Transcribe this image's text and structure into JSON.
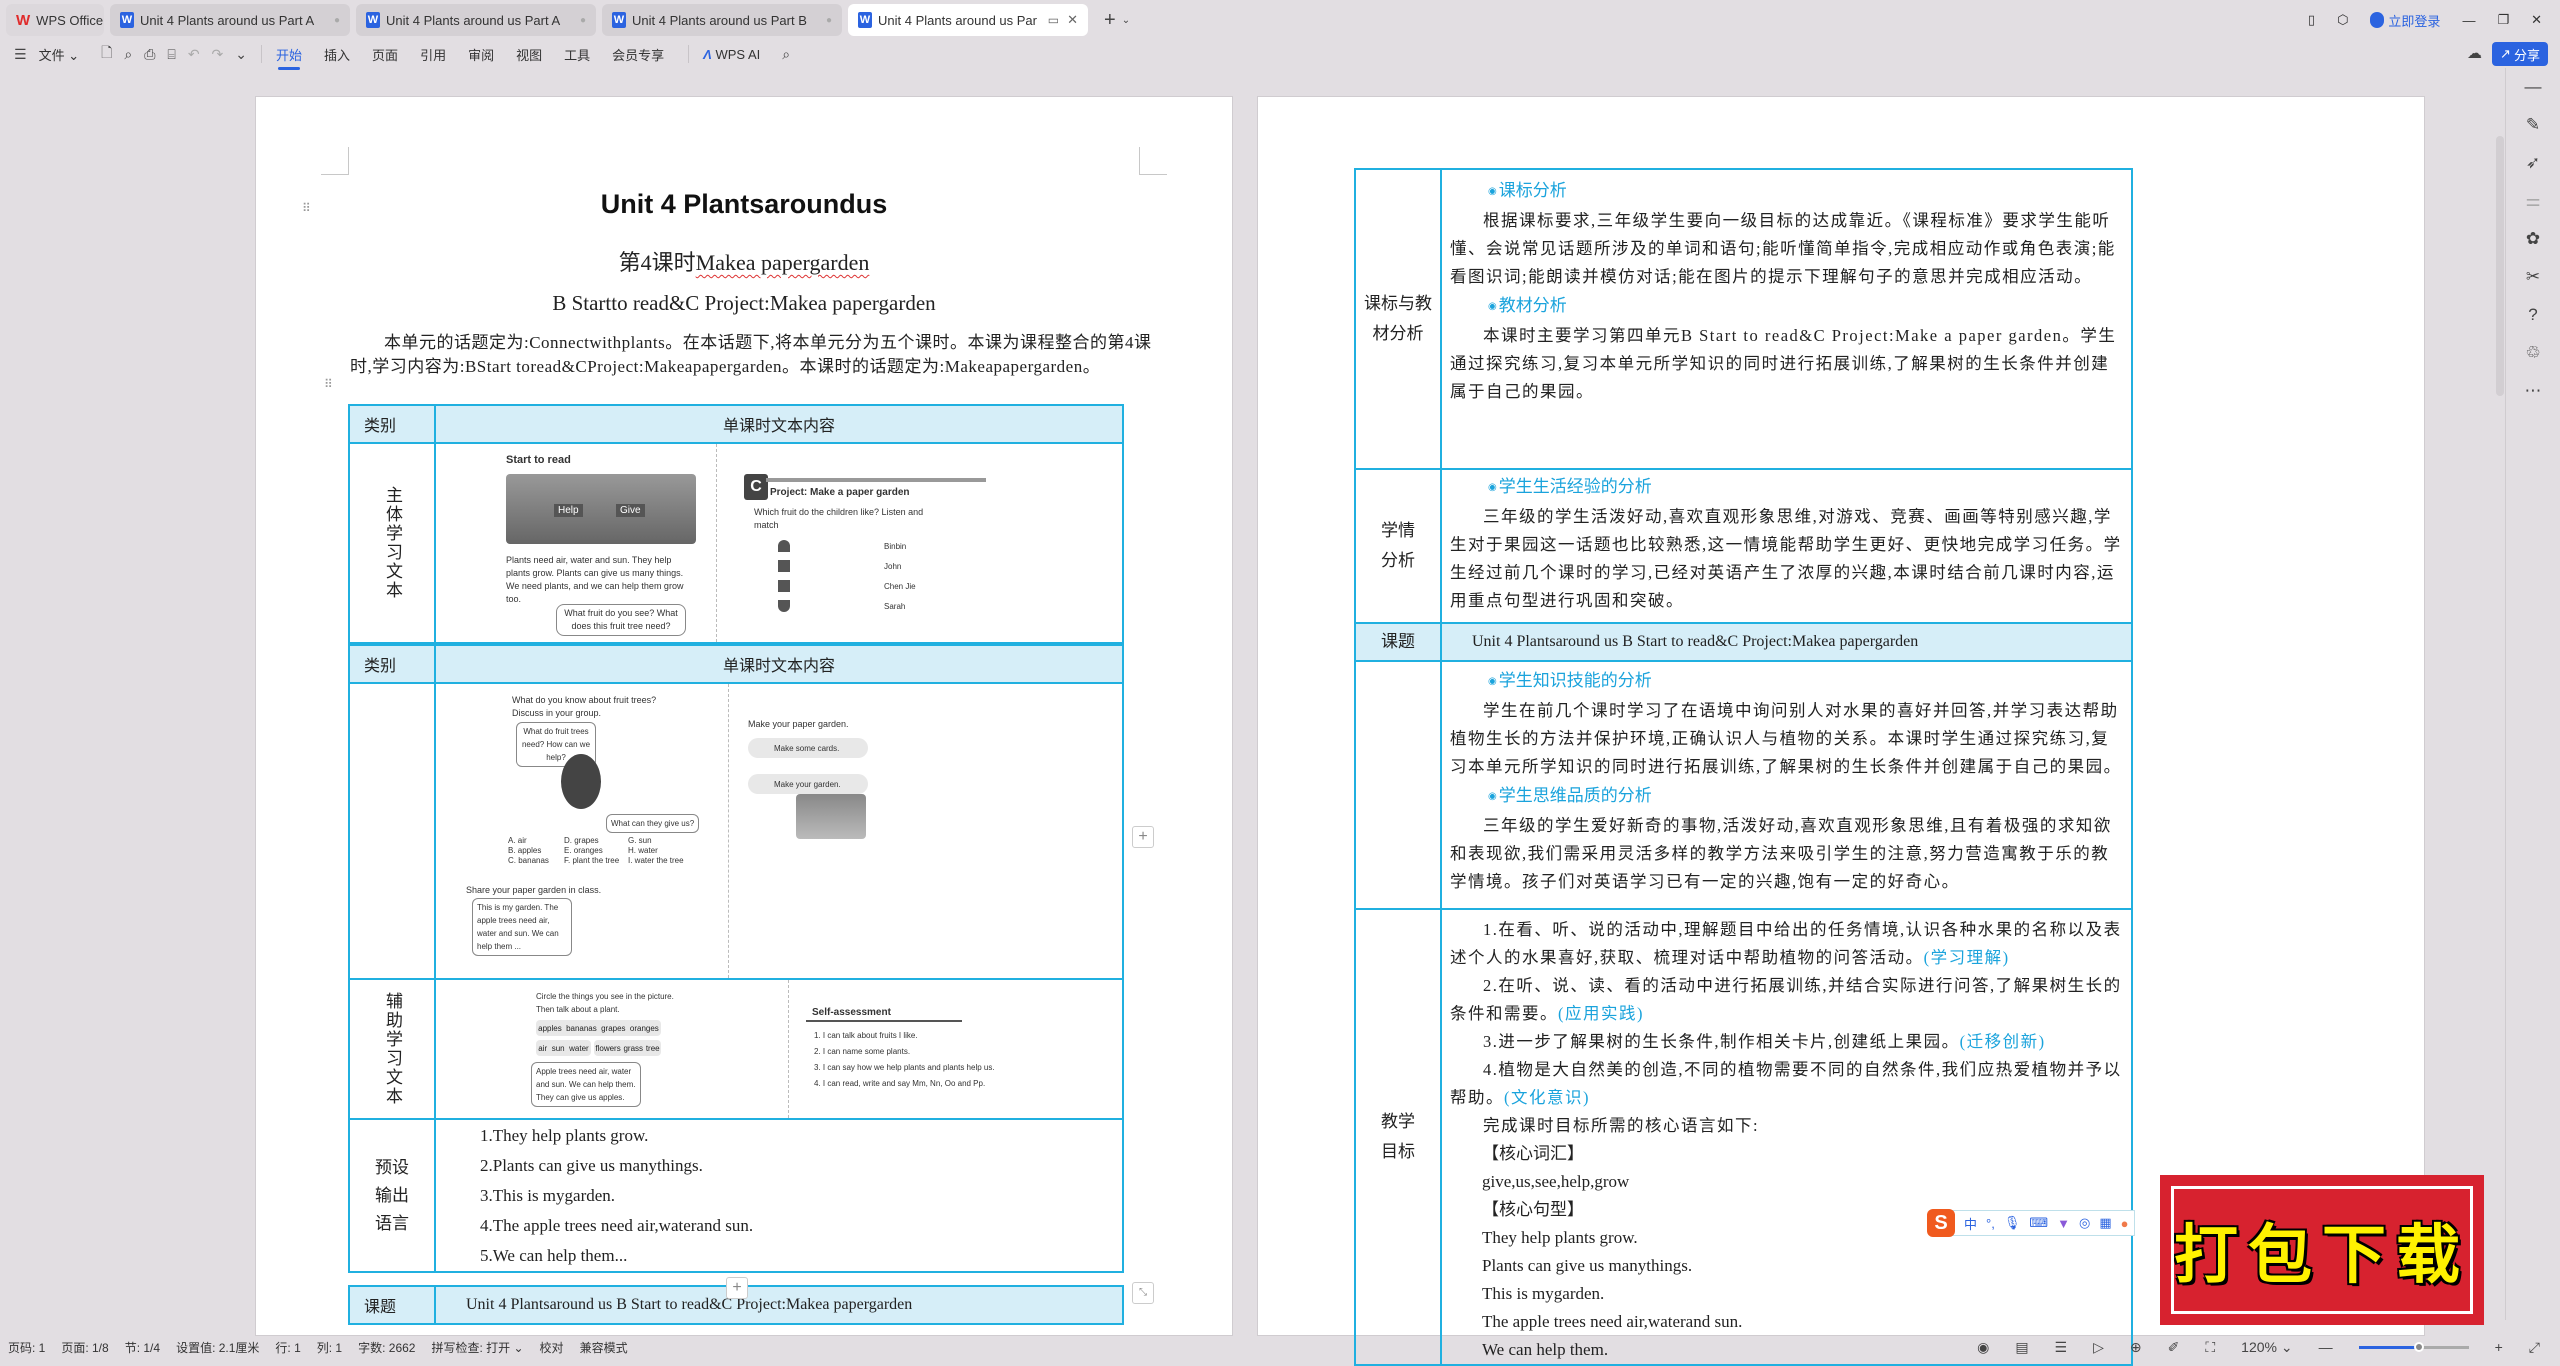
{
  "window": {
    "tabs": [
      {
        "label": "WPS Office",
        "icon": "wps-logo-icon"
      },
      {
        "label": "Unit 4  Plants around us Part A",
        "icon": "word-doc-icon"
      },
      {
        "label": "Unit 4  Plants around us Part A",
        "icon": "word-doc-icon"
      },
      {
        "label": "Unit 4  Plants around us Part B",
        "icon": "word-doc-icon"
      },
      {
        "label": "Unit 4  Plants around us Par",
        "icon": "word-doc-icon",
        "active": true
      }
    ],
    "login_label": "立即登录"
  },
  "toolbar": {
    "file_label": "文件",
    "menu": [
      "开始",
      "插入",
      "页面",
      "引用",
      "审阅",
      "视图",
      "工具",
      "会员专享"
    ],
    "active_menu": "开始",
    "wps_ai_label": "WPS AI",
    "share_label": "分享"
  },
  "left_page": {
    "title": "Unit 4 Plantsaroundus",
    "lesson_prefix": "第4课时",
    "lesson_title": "Makea papergarden",
    "subtitle": "B Startto read&C Project:Makea papergarden",
    "intro": "本单元的话题定为:Connectwithplants。在本话题下,将本单元分为五个课时。本课为课程整合的第4课时,学习内容为:BStart toread&CProject:Makeapapergarden。本课时的话题定为:Makeapapergarden。",
    "table1": {
      "col1_header": "类别",
      "col2_header": "单课时文本内容",
      "row_label": "主体学习文本",
      "img_left": {
        "heading": "Start to read",
        "arrow_labels": [
          "Help",
          "Give"
        ],
        "text": "Plants need air, water and sun. They help plants grow. Plants can give us many things. We need plants, and we can help them grow too.",
        "bubble": "What fruit do you see? What does this fruit tree need?"
      },
      "img_right": {
        "heading": "Project: Make a paper garden",
        "q1": "Which fruit do the children like? Listen and match",
        "names": [
          "Binbin",
          "John",
          "Chen Jie",
          "Sarah"
        ]
      }
    },
    "table2": {
      "col1_header": "类别",
      "col2_header": "单课时文本内容",
      "img_left": {
        "q2": "What do you know about fruit trees? Discuss in your group.",
        "bubble1": "What do fruit trees need? How can we help?",
        "bubble2": "What can they give us?",
        "options": [
          "A. air",
          "B. apples",
          "C. bananas",
          "D. grapes",
          "E. oranges",
          "F. plant the tree",
          "G. sun",
          "H. water",
          "I. water the tree"
        ],
        "q4": "Share your paper garden in class.",
        "bubble3": "This is my garden. The apple trees need air, water and sun. We can help them ..."
      },
      "img_right": {
        "q3": "Make your paper garden.",
        "steps": [
          "Make some cards.",
          "Make your garden."
        ]
      },
      "aux_label": "辅助学习文本",
      "aux_left": {
        "instruction": "Circle the things you see in the picture. Then talk about a plant.",
        "words_row1": [
          "apples",
          "bananas",
          "grapes",
          "oranges"
        ],
        "words_row2a": [
          "air",
          "sun",
          "water"
        ],
        "words_row2b": [
          "flowers",
          "grass",
          "tree"
        ],
        "bubble": "Apple trees need air, water and sun. We can help them. They can give us apples."
      },
      "aux_right": {
        "heading": "Self-assessment",
        "items": [
          "1. I can talk about fruits I like.",
          "2. I can name some plants.",
          "3. I can say how we help plants and plants help us.",
          "4. I can read, write and say Mm, Nn, Oo and Pp."
        ]
      },
      "output_label": "预设输出语言",
      "output_lines": [
        "1.They help plants grow.",
        "2.Plants can give us manythings.",
        "3.This is mygarden.",
        "4.The apple trees need air,waterand sun.",
        "5.We can help them..."
      ]
    },
    "topic_row": {
      "label": "课题",
      "value": "Unit 4  Plantsaround us B Start to read&C Project:Makea papergarden"
    }
  },
  "right_page": {
    "standards": {
      "label": "课标与教材分析",
      "h1": "课标分析",
      "p1": "根据课标要求,三年级学生要向一级目标的达成靠近。《课程标准》要求学生能听懂、会说常见话题所涉及的单词和语句;能听懂简单指令,完成相应动作或角色表演;能看图识词;能朗读并模仿对话;能在图片的提示下理解句子的意思并完成相应活动。",
      "h2": "教材分析",
      "p2": "本课时主要学习第四单元B Start to read&C Project:Make a paper garden。学生通过探究练习,复习本单元所学知识的同时进行拓展训练,了解果树的生长条件并创建属于自己的果园。"
    },
    "learner": {
      "label": "学情分析",
      "h1": "学生生活经验的分析",
      "p1": "三年级的学生活泼好动,喜欢直观形象思维,对游戏、竞赛、画画等特别感兴趣,学生对于果园这一话题也比较熟悉,这一情境能帮助学生更好、更快地完成学习任务。学生经过前几个课时的学习,已经对英语产生了浓厚的兴趣,本课时结合前几课时内容,运用重点句型进行巩固和突破。"
    },
    "topic_row": {
      "label": "课题",
      "value": "Unit 4  Plantsaround us B Start to read&C Project:Makea papergarden"
    },
    "skills": {
      "h1": "学生知识技能的分析",
      "p1": "学生在前几个课时学习了在语境中询问别人对水果的喜好并回答,并学习表达帮助植物生长的方法并保护环境,正确认识人与植物的关系。本课时学生通过探究练习,复习本单元所学知识的同时进行拓展训练,了解果树的生长条件并创建属于自己的果园。",
      "h2": "学生思维品质的分析",
      "p2": "三年级的学生爱好新奇的事物,活泼好动,喜欢直观形象思维,且有着极强的求知欲和表现欲,我们需采用灵活多样的教学方法来吸引学生的注意,努力营造寓教于乐的教学情境。孩子们对英语学习已有一定的兴趣,饱有一定的好奇心。"
    },
    "goals": {
      "label": "教学目标",
      "items": [
        {
          "text": "1.在看、听、说的活动中,理解题目中给出的任务情境,认识各种水果的名称以及表述个人的水果喜好,获取、梳理对话中帮助植物的问答活动。",
          "tag": "(学习理解)"
        },
        {
          "text": "2.在听、说、读、看的活动中进行拓展训练,并结合实际进行问答,了解果树生长的条件和需要。",
          "tag": "(应用实践)"
        },
        {
          "text": "3.进一步了解果树的生长条件,制作相关卡片,创建纸上果园。",
          "tag": "(迁移创新)"
        },
        {
          "text": "4.植物是大自然美的创造,不同的植物需要不同的自然条件,我们应热爱植物并予以帮助。",
          "tag": "(文化意识)"
        }
      ],
      "core_intro": "完成课时目标所需的核心语言如下:",
      "vocab_label": "【核心词汇】",
      "vocab": "give,us,see,help,grow",
      "pattern_label": "【核心句型】",
      "patterns": [
        "They help plants grow.",
        "Plants can give us manythings.",
        "This is mygarden.",
        "The apple trees need air,waterand sun.",
        "We can help them."
      ]
    }
  },
  "statusbar": {
    "items": [
      "页码: 1",
      "页面: 1/8",
      "节: 1/4",
      "设置值: 2.1厘米",
      "行: 1",
      "列: 1",
      "字数: 2662",
      "拼写检查: 打开",
      "校对",
      "兼容模式"
    ],
    "zoom_label": "120%",
    "zoom_fraction": 0.55
  },
  "ime": {
    "logo": "S",
    "mode": "中"
  },
  "overlay_stamp": "打包下载"
}
